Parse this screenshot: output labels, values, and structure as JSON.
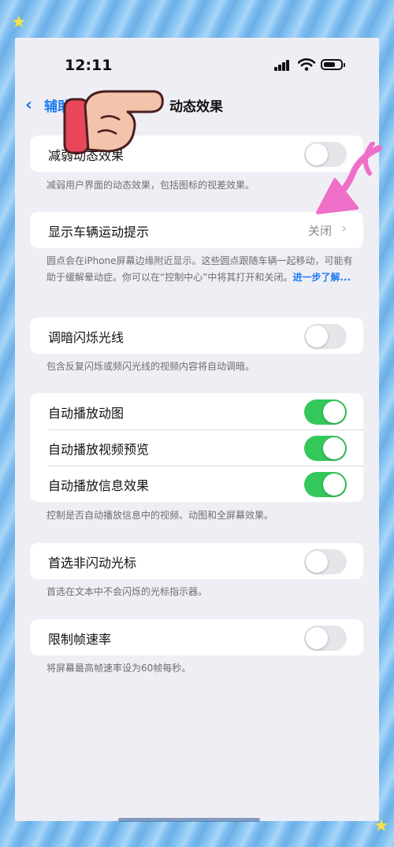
{
  "status_bar": {
    "time": "12:11"
  },
  "nav": {
    "back_label": "辅助功能",
    "title": "动态效果"
  },
  "sections": {
    "reduce_motion": {
      "label": "减弱动态效果",
      "on": false,
      "footer": "减弱用户界面的动态效果，包括图标的视差效果。"
    },
    "vehicle_cues": {
      "label": "显示车辆运动提示",
      "value": "关闭",
      "footer": "圆点会在iPhone屏幕边缘附近显示。这些圆点跟随车辆一起移动，可能有助于缓解晕动症。你可以在“控制中心”中将其打开和关闭。",
      "link": "进一步了解..."
    },
    "dim_flashing": {
      "label": "调暗闪烁光线",
      "on": false,
      "footer": "包含反复闪烁或频闪光线的视频内容将自动调暗。"
    },
    "autoplay": {
      "animated_images": {
        "label": "自动播放动图",
        "on": true
      },
      "video_previews": {
        "label": "自动播放视频预览",
        "on": true
      },
      "message_effects": {
        "label": "自动播放信息效果",
        "on": true
      },
      "footer": "控制是否自动播放信息中的视频、动图和全屏幕效果。"
    },
    "non_blinking_cursor": {
      "label": "首选非闪动光标",
      "on": false,
      "footer": "首选在文本中不会闪烁的光标指示器。"
    },
    "limit_frame_rate": {
      "label": "限制帧速率",
      "on": false,
      "footer": "将屏幕最高帧速率设为60帧每秒。"
    }
  },
  "colors": {
    "accent": "#1c7cf2",
    "toggle_on": "#34c759",
    "toggle_off": "#e6e5ea",
    "background": "#f0eef5",
    "arrow": "#ee6fc8",
    "hand_cuff": "#e8475a"
  },
  "icons": [
    "chevron-left-icon",
    "signal-icon",
    "wifi-icon",
    "battery-icon",
    "chevron-right-icon",
    "pointing-hand-sticker",
    "pink-arrow-sticker"
  ]
}
